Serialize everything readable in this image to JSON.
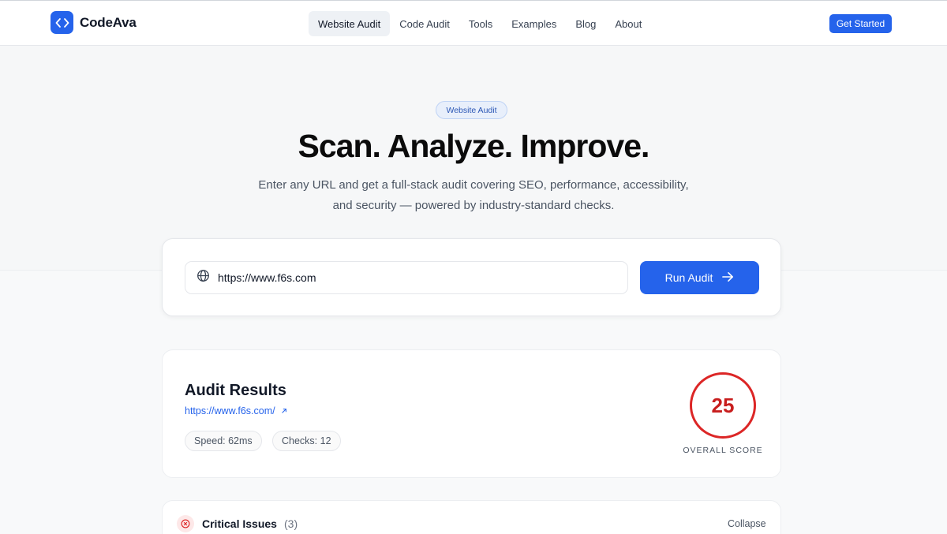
{
  "brand": {
    "name": "CodeAva",
    "accent": "#2563eb"
  },
  "nav": {
    "items": [
      {
        "label": "Website Audit",
        "active": true
      },
      {
        "label": "Code Audit"
      },
      {
        "label": "Tools"
      },
      {
        "label": "Examples"
      },
      {
        "label": "Blog"
      },
      {
        "label": "About"
      }
    ],
    "cta": "Get Started"
  },
  "hero": {
    "badge": "Website Audit",
    "title": "Scan. Analyze. Improve.",
    "subtitle_line1": "Enter any URL and get a full-stack audit covering SEO, performance, accessibility,",
    "subtitle_line2": "and security — powered by industry-standard checks."
  },
  "audit_form": {
    "url_value": "https://www.f6s.com",
    "icon": "globe-icon",
    "button_label": "Run Audit"
  },
  "results": {
    "title": "Audit Results",
    "url": "https://www.f6s.com/",
    "speed": "Speed: 62ms",
    "checks": "Checks: 12",
    "score": "25",
    "score_label": "OVERALL SCORE",
    "score_color": "#dc2626"
  },
  "critical": {
    "title": "Critical Issues",
    "count": "(3)",
    "collapse_label": "Collapse",
    "color": "#dc2626"
  }
}
